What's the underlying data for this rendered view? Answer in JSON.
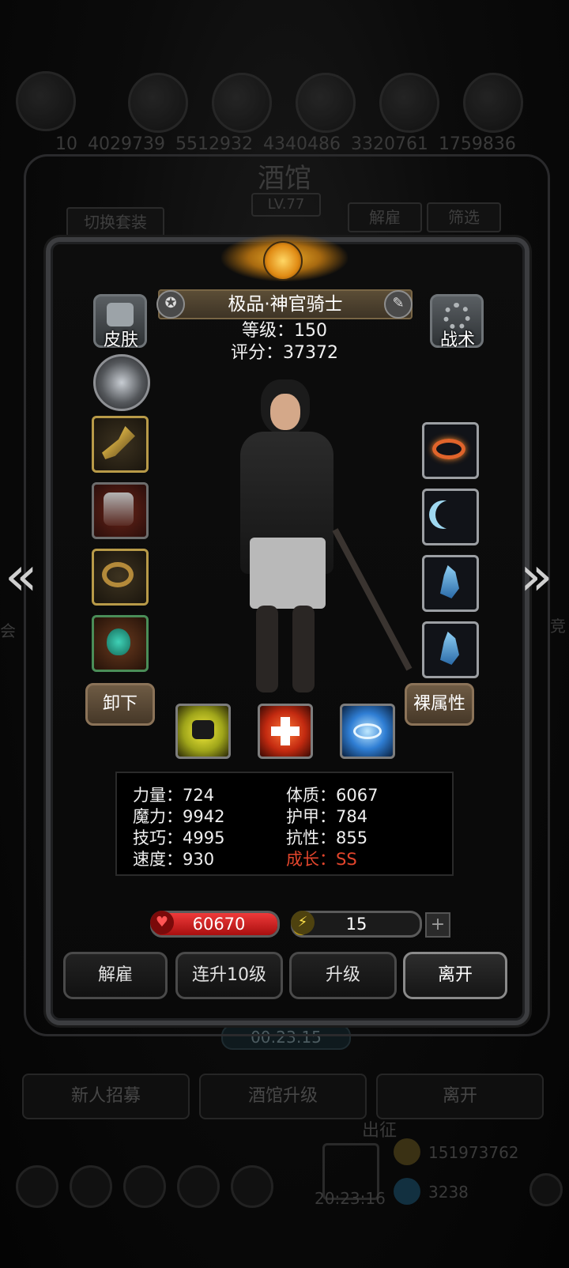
{
  "background": {
    "resource_values": [
      "10",
      "4029739",
      "5512932",
      "4340486",
      "3320761",
      "1759836"
    ],
    "title": "酒馆",
    "level": "LV.77",
    "switch_outfit": "切换套装",
    "dismiss": "解雇",
    "filter": "筛选",
    "timer": "00:23:15",
    "recruit": "新人招募",
    "upgrade_tavern": "酒馆升级",
    "leave": "离开",
    "deploy": "出征",
    "gold_amount": "151973762",
    "timer2": "20:23:16",
    "gem_amount": "3238",
    "side_left": "会",
    "side_right": "竞"
  },
  "hero": {
    "name": "极品·神官骑士",
    "level_label": "等级：150",
    "score_label": "评分：37372"
  },
  "buttons": {
    "skin": "皮肤",
    "tactics": "战术",
    "unequip": "卸下",
    "naked_attr": "裸属性"
  },
  "stats": {
    "strength": "力量：724",
    "magic": "魔力：9942",
    "skill": "技巧：4995",
    "speed": "速度：930",
    "constitution": "体质：6067",
    "armor": "护甲：784",
    "resistance": "抗性：855",
    "growth": "成长：SS"
  },
  "bars": {
    "hp": "60670",
    "energy": "15",
    "energy_fill": 0.12
  },
  "actions": {
    "dismiss": "解雇",
    "level_up_10": "连升10级",
    "level_up": "升级",
    "leave": "离开"
  },
  "colors": {
    "accent_gold": "#f3b12a",
    "hp_red": "#d81c1c",
    "energy_yellow": "#e6c21e",
    "growth_red": "#e2452c"
  }
}
